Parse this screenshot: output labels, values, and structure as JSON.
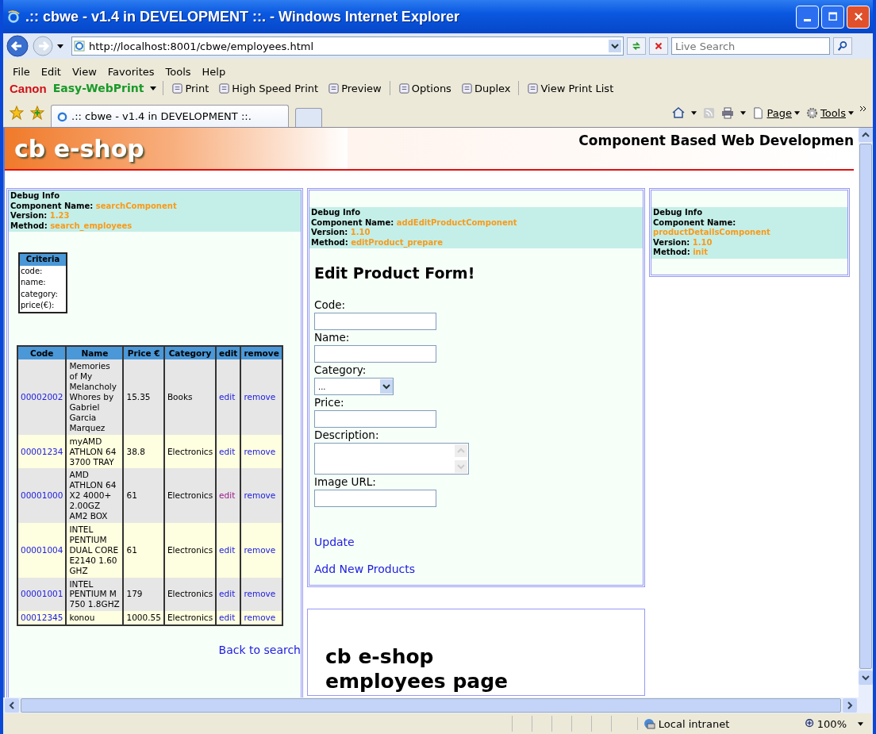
{
  "window": {
    "title": ".:: cbwe - v1.4 in DEVELOPMENT ::. - Windows Internet Explorer"
  },
  "address_bar": {
    "url": "http://localhost:8001/cbwe/employees.html"
  },
  "search": {
    "placeholder": "Live Search"
  },
  "menu": [
    "File",
    "Edit",
    "View",
    "Favorites",
    "Tools",
    "Help"
  ],
  "print_toolbar": {
    "brand": "Canon",
    "product": "Easy-WebPrint",
    "buttons": [
      "Print",
      "High Speed Print",
      "Preview",
      "Options",
      "Duplex",
      "View Print List"
    ]
  },
  "tabs": [
    {
      "label": ".:: cbwe - v1.4 in DEVELOPMENT ::.",
      "selected": true
    }
  ],
  "command_bar": [
    "Page",
    "Tools"
  ],
  "page": {
    "logo": "cb e-shop",
    "heading": "Component Based Web Developmen",
    "search_panel": {
      "debug": {
        "title": "Debug Info",
        "fields": [
          {
            "label": "Component Name:",
            "value": "searchComponent"
          },
          {
            "label": "Version:",
            "value": "1.23"
          },
          {
            "label": "Method:",
            "value": "search_employees"
          }
        ]
      },
      "criteria": {
        "title": "Criteria",
        "fields": [
          "code:",
          "name:",
          "category:",
          "price(€):"
        ]
      },
      "table": {
        "columns": [
          "Code",
          "Name",
          "Price €",
          "Category",
          "edit",
          "remove"
        ],
        "rows": [
          {
            "code": "00002002",
            "name": "Memories of My Melancholy Whores by Gabriel Garcia Marquez",
            "price": "15.35",
            "category": "Books",
            "edit": "edit",
            "edit_visited": false,
            "remove": "remove"
          },
          {
            "code": "00001234",
            "name": "myAMD ATHLON 64 3700 TRAY",
            "price": "38.8",
            "category": "Electronics",
            "edit": "edit",
            "edit_visited": false,
            "remove": "remove"
          },
          {
            "code": "00001000",
            "name": "AMD ATHLON 64 X2 4000+ 2.00GZ AM2 BOX",
            "price": "61",
            "category": "Electronics",
            "edit": "edit",
            "edit_visited": true,
            "remove": "remove"
          },
          {
            "code": "00001004",
            "name": "INTEL PENTIUM DUAL CORE E2140 1.60 GHZ",
            "price": "61",
            "category": "Electronics",
            "edit": "edit",
            "edit_visited": false,
            "remove": "remove"
          },
          {
            "code": "00001001",
            "name": "INTEL PENTIUM M 750 1.8GHZ",
            "price": "179",
            "category": "Electronics",
            "edit": "edit",
            "edit_visited": false,
            "remove": "remove"
          },
          {
            "code": "00012345",
            "name": "konou",
            "price": "1000.55",
            "category": "Electronics",
            "edit": "edit",
            "edit_visited": false,
            "remove": "remove"
          }
        ]
      },
      "back_link": "Back to search"
    },
    "form_panel": {
      "debug": {
        "title": "Debug Info",
        "fields": [
          {
            "label": "Component Name:",
            "value": "addEditProductComponent"
          },
          {
            "label": "Version:",
            "value": "1.10"
          },
          {
            "label": "Method:",
            "value": "editProduct_prepare"
          }
        ]
      },
      "title": "Edit Product Form!",
      "fields": [
        {
          "label": "Code:",
          "kind": "text"
        },
        {
          "label": "Name:",
          "kind": "text"
        },
        {
          "label": "Category:",
          "kind": "select",
          "value": "..."
        },
        {
          "label": "Price:",
          "kind": "text"
        },
        {
          "label": "Description:",
          "kind": "textarea"
        },
        {
          "label": "Image URL:",
          "kind": "text"
        }
      ],
      "links": [
        "Update",
        "Add New Products"
      ]
    },
    "details_panel": {
      "debug": {
        "title": "Debug Info",
        "fields": [
          {
            "label": "Component Name:",
            "value": "productDetailsComponent"
          },
          {
            "label": "Version:",
            "value": "1.10"
          },
          {
            "label": "Method:",
            "value": "init"
          }
        ]
      }
    },
    "bottom_panel": {
      "heading": "cb e-shop employees page"
    }
  },
  "status_bar": {
    "zone": "Local intranet",
    "zoom": "100%"
  }
}
